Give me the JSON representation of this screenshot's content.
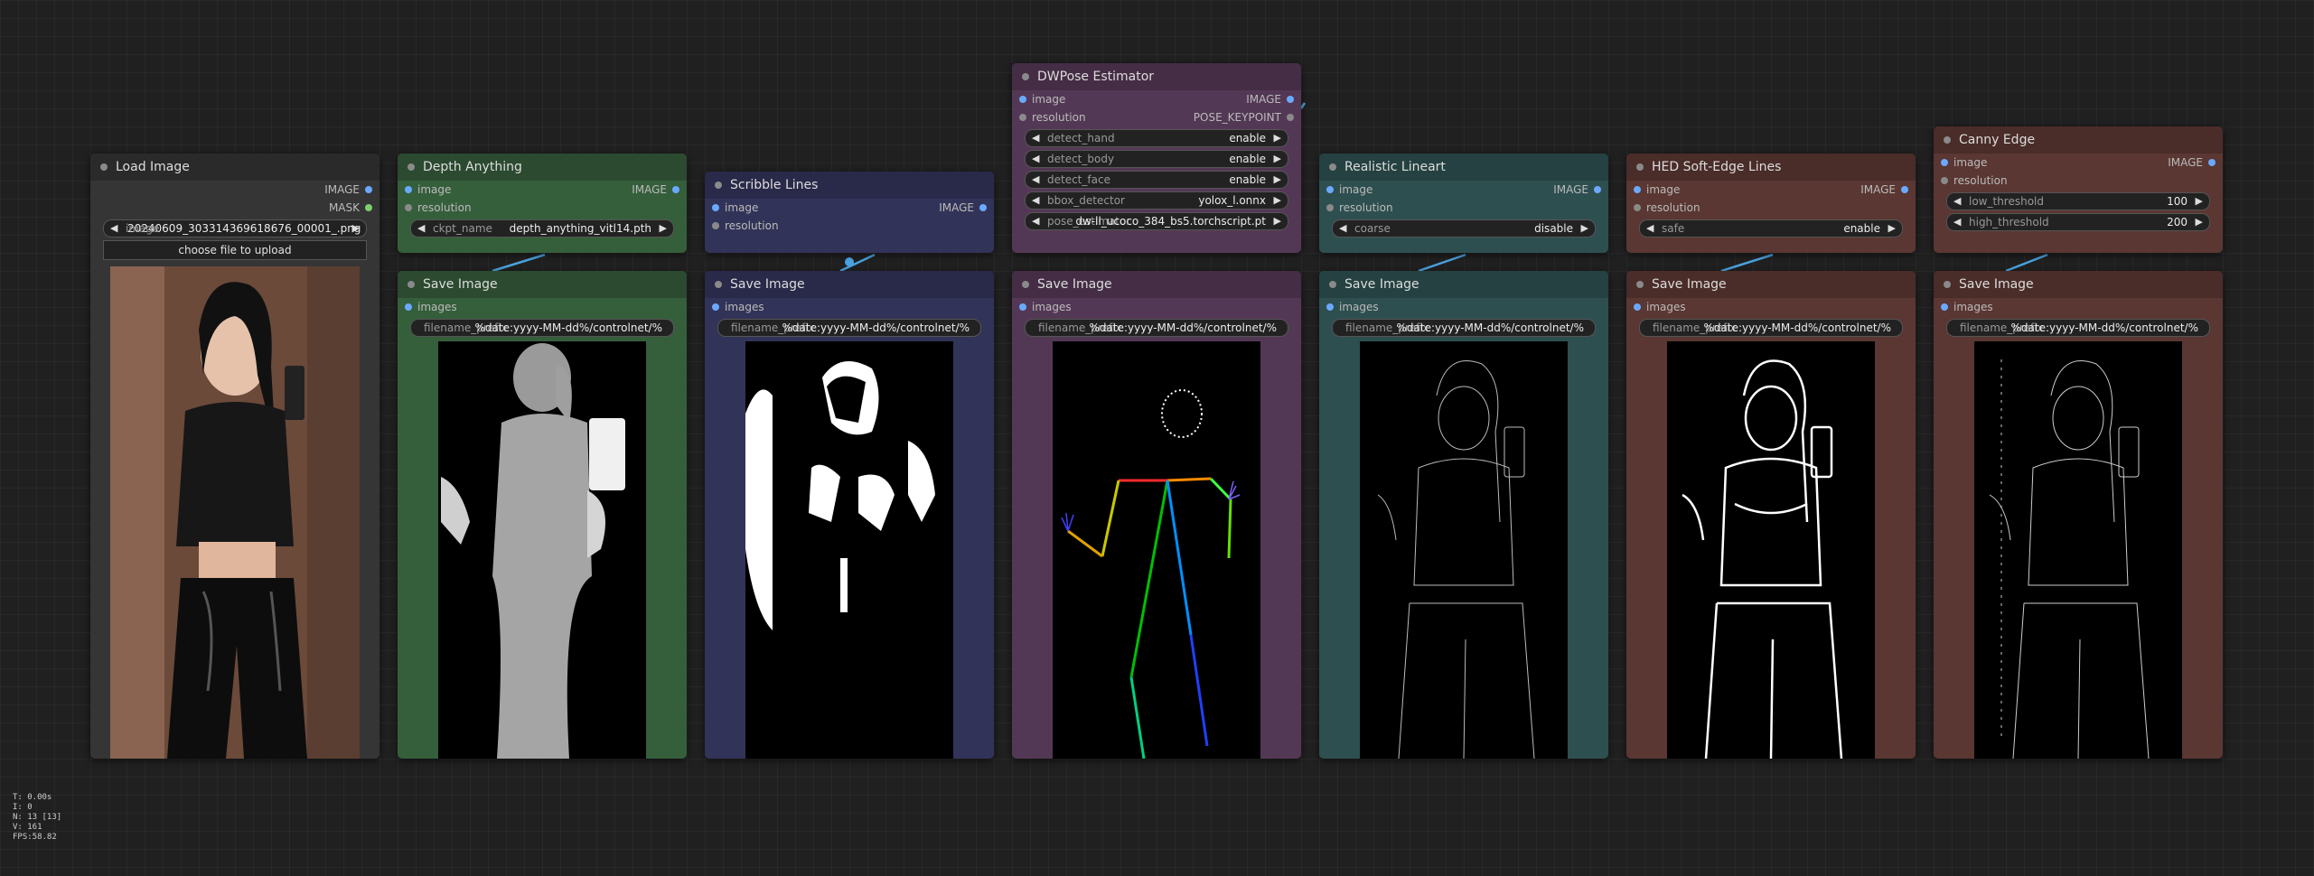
{
  "load_image": {
    "title": "Load Image",
    "outputs": [
      "IMAGE",
      "MASK"
    ],
    "image_label": "image",
    "image_value": "20240609_303314369618676_00001_.png",
    "upload_button": "choose file to upload"
  },
  "depth": {
    "title": "Depth Anything",
    "inputs": [
      "image",
      "resolution"
    ],
    "output": "IMAGE",
    "ckpt_label": "ckpt_name",
    "ckpt_value": "depth_anything_vitl14.pth"
  },
  "scribble": {
    "title": "Scribble Lines",
    "inputs": [
      "image",
      "resolution"
    ],
    "output": "IMAGE"
  },
  "dwpose": {
    "title": "DWPose Estimator",
    "inputs": [
      "image",
      "resolution"
    ],
    "outputs": [
      "IMAGE",
      "POSE_KEYPOINT"
    ],
    "widgets": [
      {
        "label": "detect_hand",
        "value": "enable"
      },
      {
        "label": "detect_body",
        "value": "enable"
      },
      {
        "label": "detect_face",
        "value": "enable"
      },
      {
        "label": "bbox_detector",
        "value": "yolox_l.onnx"
      },
      {
        "label": "pose_estimator",
        "value": "dw-ll_ucoco_384_bs5.torchscript.pt"
      }
    ]
  },
  "lineart": {
    "title": "Realistic Lineart",
    "inputs": [
      "image",
      "resolution"
    ],
    "output": "IMAGE",
    "widget_label": "coarse",
    "widget_value": "disable"
  },
  "hed": {
    "title": "HED Soft-Edge Lines",
    "inputs": [
      "image",
      "resolution"
    ],
    "output": "IMAGE",
    "widget_label": "safe",
    "widget_value": "enable"
  },
  "canny": {
    "title": "Canny Edge",
    "inputs": [
      "image",
      "resolution"
    ],
    "output": "IMAGE",
    "widgets": [
      {
        "label": "low_threshold",
        "value": "100"
      },
      {
        "label": "high_threshold",
        "value": "200"
      }
    ]
  },
  "save": {
    "title": "Save Image",
    "input": "images",
    "filename_label": "filename_prefix",
    "filename_value": "%date:yyyy-MM-dd%/controlnet/%"
  },
  "stats": {
    "t": "T: 0.00s",
    "i": "I: 0",
    "n": "N: 13 [13]",
    "v": "V: 161",
    "fps": "FPS:58.82"
  },
  "colors": {
    "background": "#202020",
    "link": "#4aa3e0",
    "green": "#355e3b",
    "blue": "#323358",
    "purple": "#533855",
    "teal": "#2e4f4f",
    "brown": "#5a3732",
    "gray": "#353535"
  }
}
